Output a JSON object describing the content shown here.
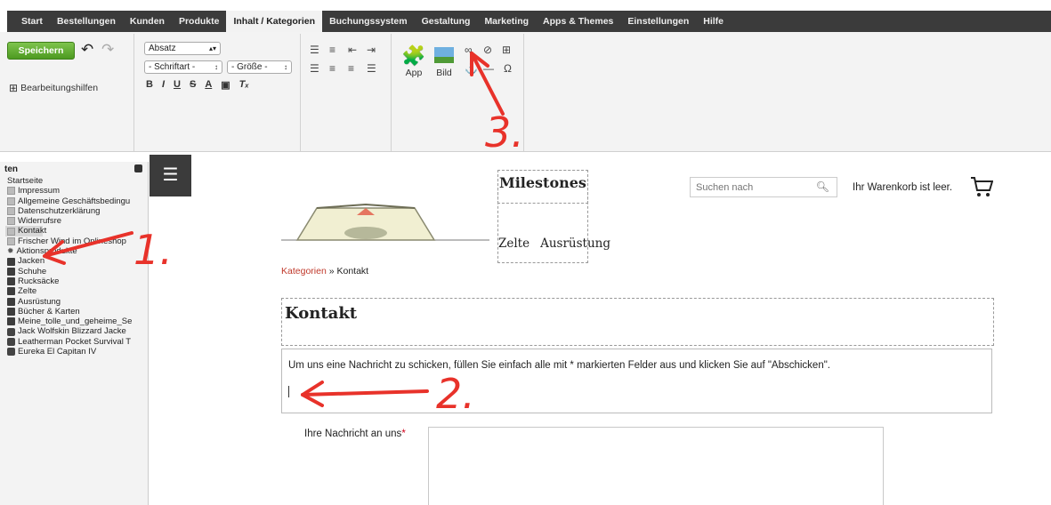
{
  "menu": [
    "Start",
    "Bestellungen",
    "Kunden",
    "Produkte",
    "Inhalt / Kategorien",
    "Buchungssystem",
    "Gestaltung",
    "Marketing",
    "Apps & Themes",
    "Einstellungen",
    "Hilfe"
  ],
  "menu_active": "Inhalt / Kategorien",
  "toolbar": {
    "save_label": "Speichern",
    "help_label": "Bearbeitungshilfen",
    "paragraph_select": "Absatz",
    "font_select": "- Schriftart -",
    "size_select": "- Größe -",
    "app_label": "App",
    "image_label": "Bild",
    "icons": [
      "undo-icon",
      "redo-icon",
      "table-icon",
      "bullet-list-icon",
      "numbered-list-icon",
      "indent-icon",
      "outdent-icon",
      "align-left-icon",
      "align-center-icon",
      "align-right-icon",
      "justify-icon",
      "puzzle-icon",
      "image-icon",
      "link-icon",
      "unlink-icon",
      "anchor-icon",
      "omega-icon"
    ]
  },
  "tree": {
    "title": "ten",
    "items": [
      {
        "label": "Startseite",
        "icon": "none"
      },
      {
        "label": "Impressum",
        "icon": "page"
      },
      {
        "label": "Allgemeine Geschäftsbedingu",
        "icon": "page"
      },
      {
        "label": "Datenschutzerklärung",
        "icon": "page"
      },
      {
        "label": "Widerrufsre",
        "icon": "page"
      },
      {
        "label": "Kontakt",
        "icon": "page",
        "selected": true
      },
      {
        "label": "Frischer Wind im Onlineshop",
        "icon": "page"
      },
      {
        "label": "Aktionsprodukte",
        "icon": "star"
      },
      {
        "label": "Jacken",
        "icon": "folder"
      },
      {
        "label": "Schuhe",
        "icon": "folder"
      },
      {
        "label": "Rucksäcke",
        "icon": "folder"
      },
      {
        "label": "Zelte",
        "icon": "folder"
      },
      {
        "label": "Ausrüstung",
        "icon": "folder"
      },
      {
        "label": "Bücher & Karten",
        "icon": "folder"
      },
      {
        "label": "Meine_tolle_und_geheime_Se",
        "icon": "folder"
      },
      {
        "label": "Jack Wolfskin Blizzard Jacke",
        "icon": "box"
      },
      {
        "label": "Leatherman Pocket Survival T",
        "icon": "box"
      },
      {
        "label": "Eureka El Capitan IV",
        "icon": "box"
      }
    ]
  },
  "annotations": [
    "1.",
    "2.",
    "3."
  ],
  "shop": {
    "title": "Milestones",
    "nav": [
      "Zelte",
      "Ausrüstung"
    ],
    "search_placeholder": "Suchen nach",
    "cart_text": "Ihr Warenkorb ist leer."
  },
  "breadcrumb": {
    "link": "Kategorien",
    "sep": "»",
    "current": "Kontakt"
  },
  "page_title": "Kontakt",
  "intro": "Um uns eine Nachricht zu schicken, füllen Sie einfach alle mit * markierten Felder aus und klicken Sie auf \"Abschicken\".",
  "form": {
    "message_label": "Ihre Nachricht an uns",
    "required_mark": "*"
  },
  "colors": {
    "menubar": "#3b3b3b",
    "save_button": "#5aab2b",
    "annotation": "#e8322a",
    "link": "#c0392b"
  }
}
